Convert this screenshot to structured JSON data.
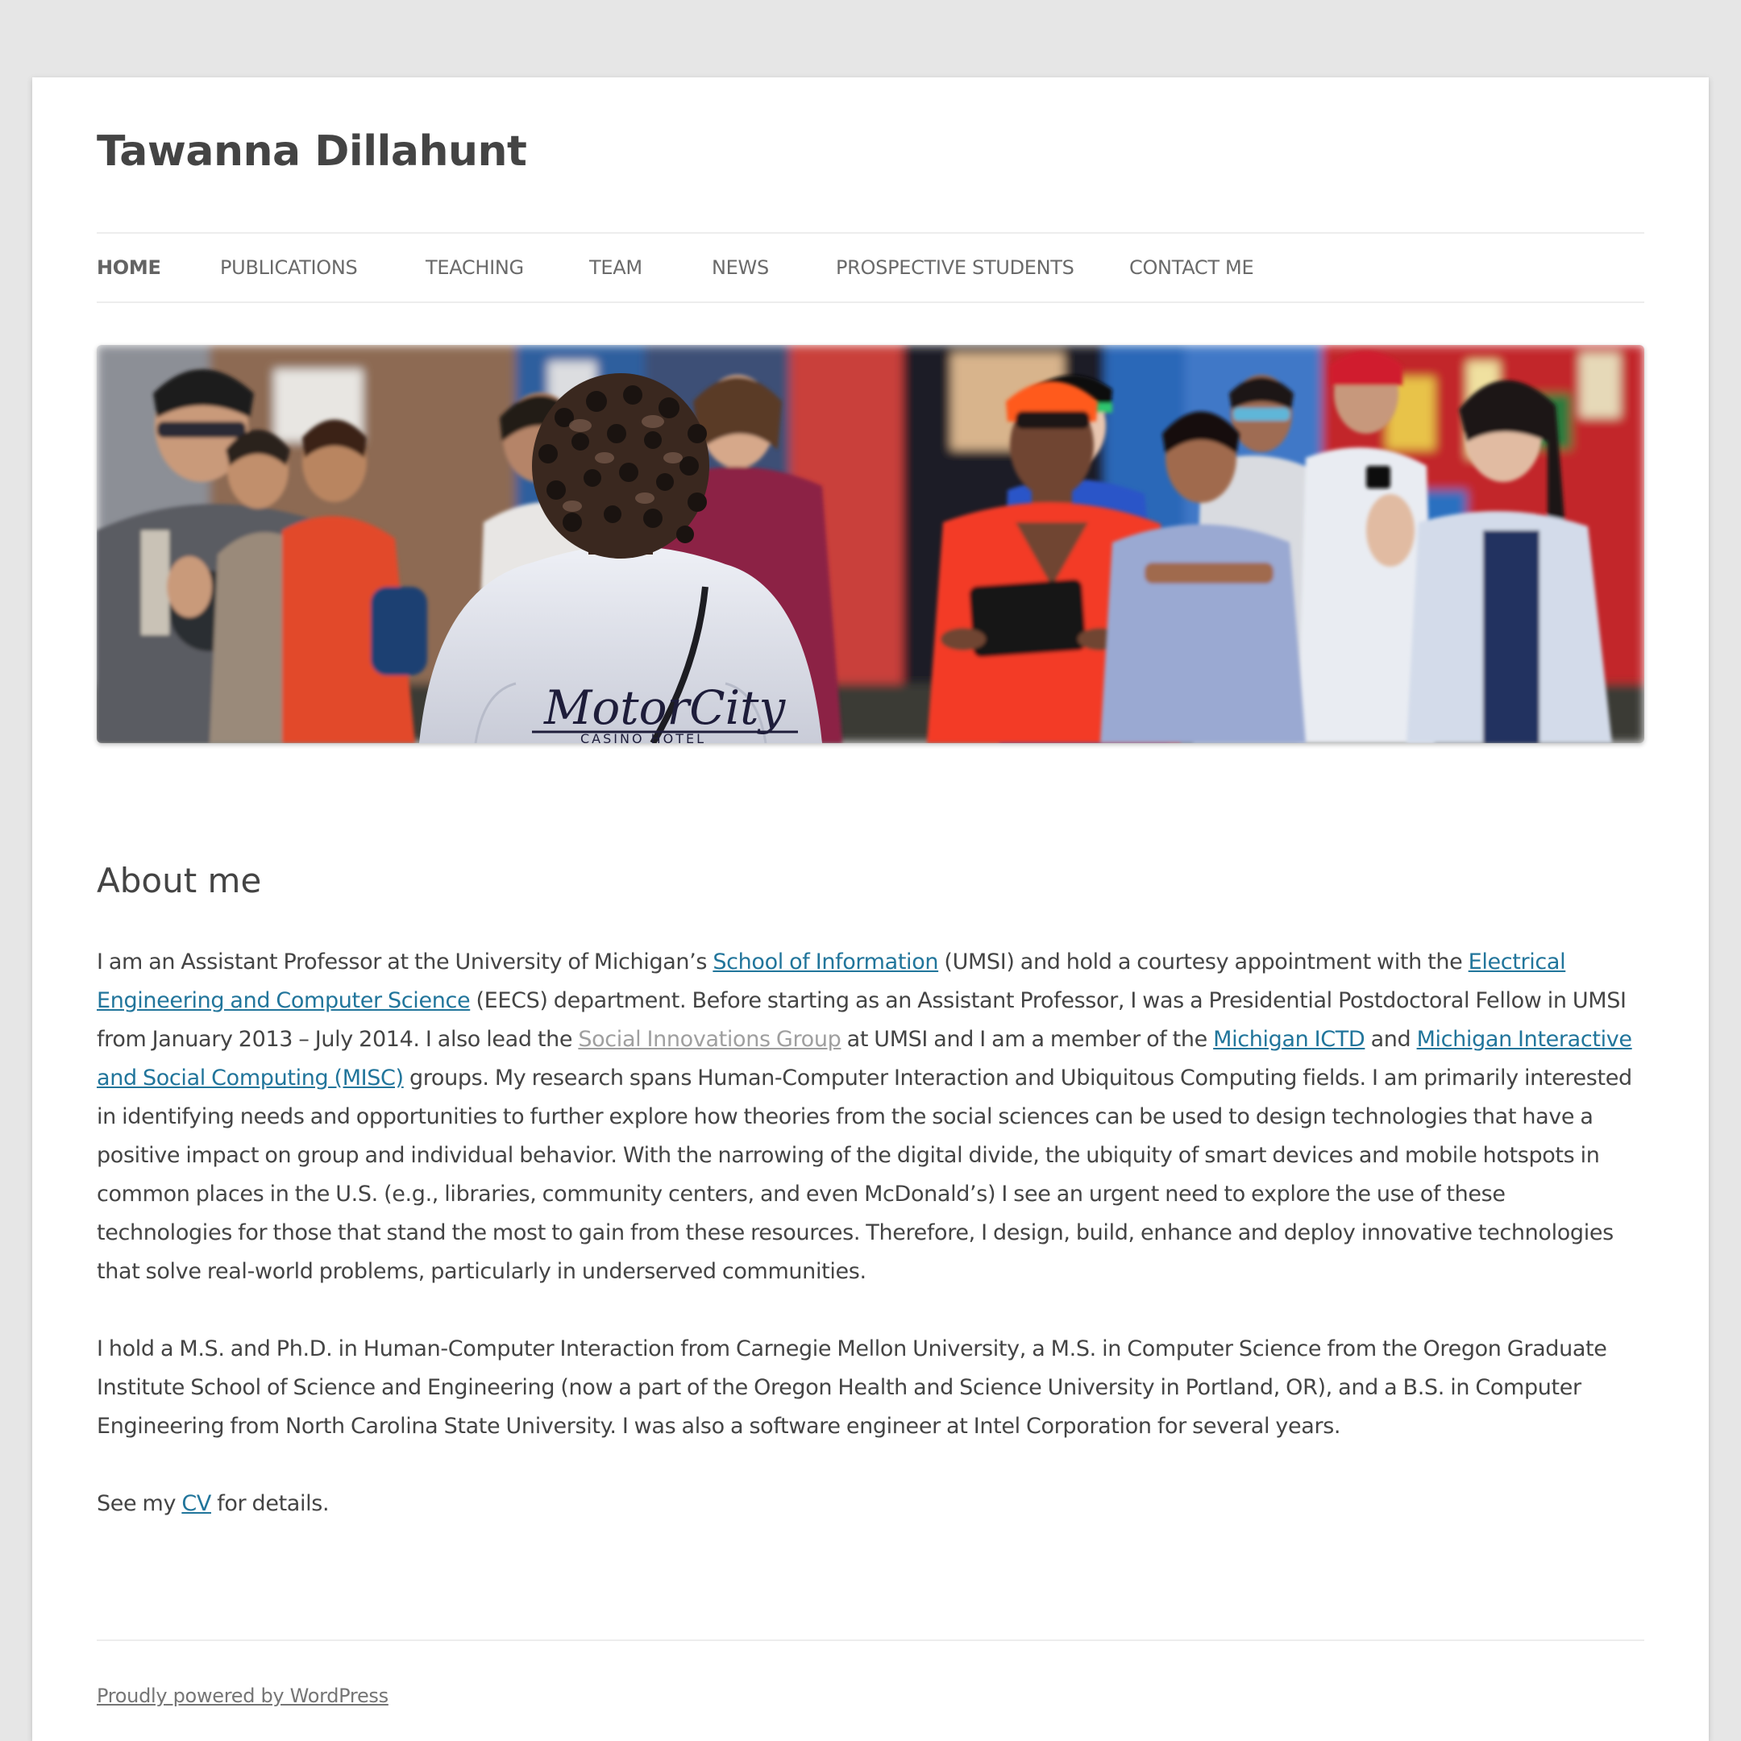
{
  "site": {
    "title": "Tawanna Dillahunt"
  },
  "nav": {
    "items": [
      {
        "label": "Home",
        "active": true
      },
      {
        "label": "Publications"
      },
      {
        "label": "Teaching"
      },
      {
        "label": "Team"
      },
      {
        "label": "News"
      },
      {
        "label": "Prospective Students"
      },
      {
        "label": "Contact Me"
      }
    ]
  },
  "header_image": {
    "alt": "Group of people outdoors in front of a colorful mural",
    "shirt_text": "MotorCity",
    "shirt_subtext": "CASINO HOTEL"
  },
  "main": {
    "title": "About me",
    "p1": {
      "t1": "I am an Assistant Professor at the University of Michigan’s ",
      "link1": "School of Information",
      "t2": " (UMSI) and hold a courtesy appointment with the ",
      "link2": "Electrical Engineering and Computer Science",
      "t3": " (EECS) department. Before starting as an Assistant Professor, I was a Presidential Postdoctoral Fellow in UMSI from January 2013 – July 2014. I also lead the ",
      "link3": "Social Innovations Group",
      "t4": " at UMSI and I am a member of the ",
      "link4": "Michigan ICTD",
      "t5": " and ",
      "link5": "Michigan Interactive and Social Computing (MISC)",
      "t6": " groups. My research spans Human-Computer Interaction and Ubiquitous Computing fields. I am primarily interested in identifying needs and opportunities to further explore how theories from the social sciences can be used to design technologies that have a positive impact on group and individual behavior. With the narrowing of the digital divide, the ubiquity of smart devices and mobile hotspots in common places in the U.S. (e.g., libraries, community centers, and even McDonald’s) I see an urgent need to explore the use of these technologies for those that stand the most to gain from these resources. Therefore, I design, build, enhance and deploy innovative technologies that solve real-world problems, particularly in underserved communities."
    },
    "p2": "I hold a M.S. and Ph.D. in Human-Computer Interaction from Carnegie Mellon University, a M.S. in Computer Science from the Oregon Graduate Institute School of Science and Engineering (now a part of the Oregon Health and Science University in Portland, OR), and a B.S. in Computer Engineering from North Carolina State University. I was also a software engineer at Intel Corporation for several years.",
    "p3": {
      "t1": "See my ",
      "link": "CV",
      "t2": " for details."
    }
  },
  "footer": {
    "credit": "Proudly powered by WordPress"
  },
  "colors": {
    "link": "#21759b",
    "visited_link": "#9f9f9f",
    "text": "#444444",
    "page_background": "#e6e6e6"
  }
}
